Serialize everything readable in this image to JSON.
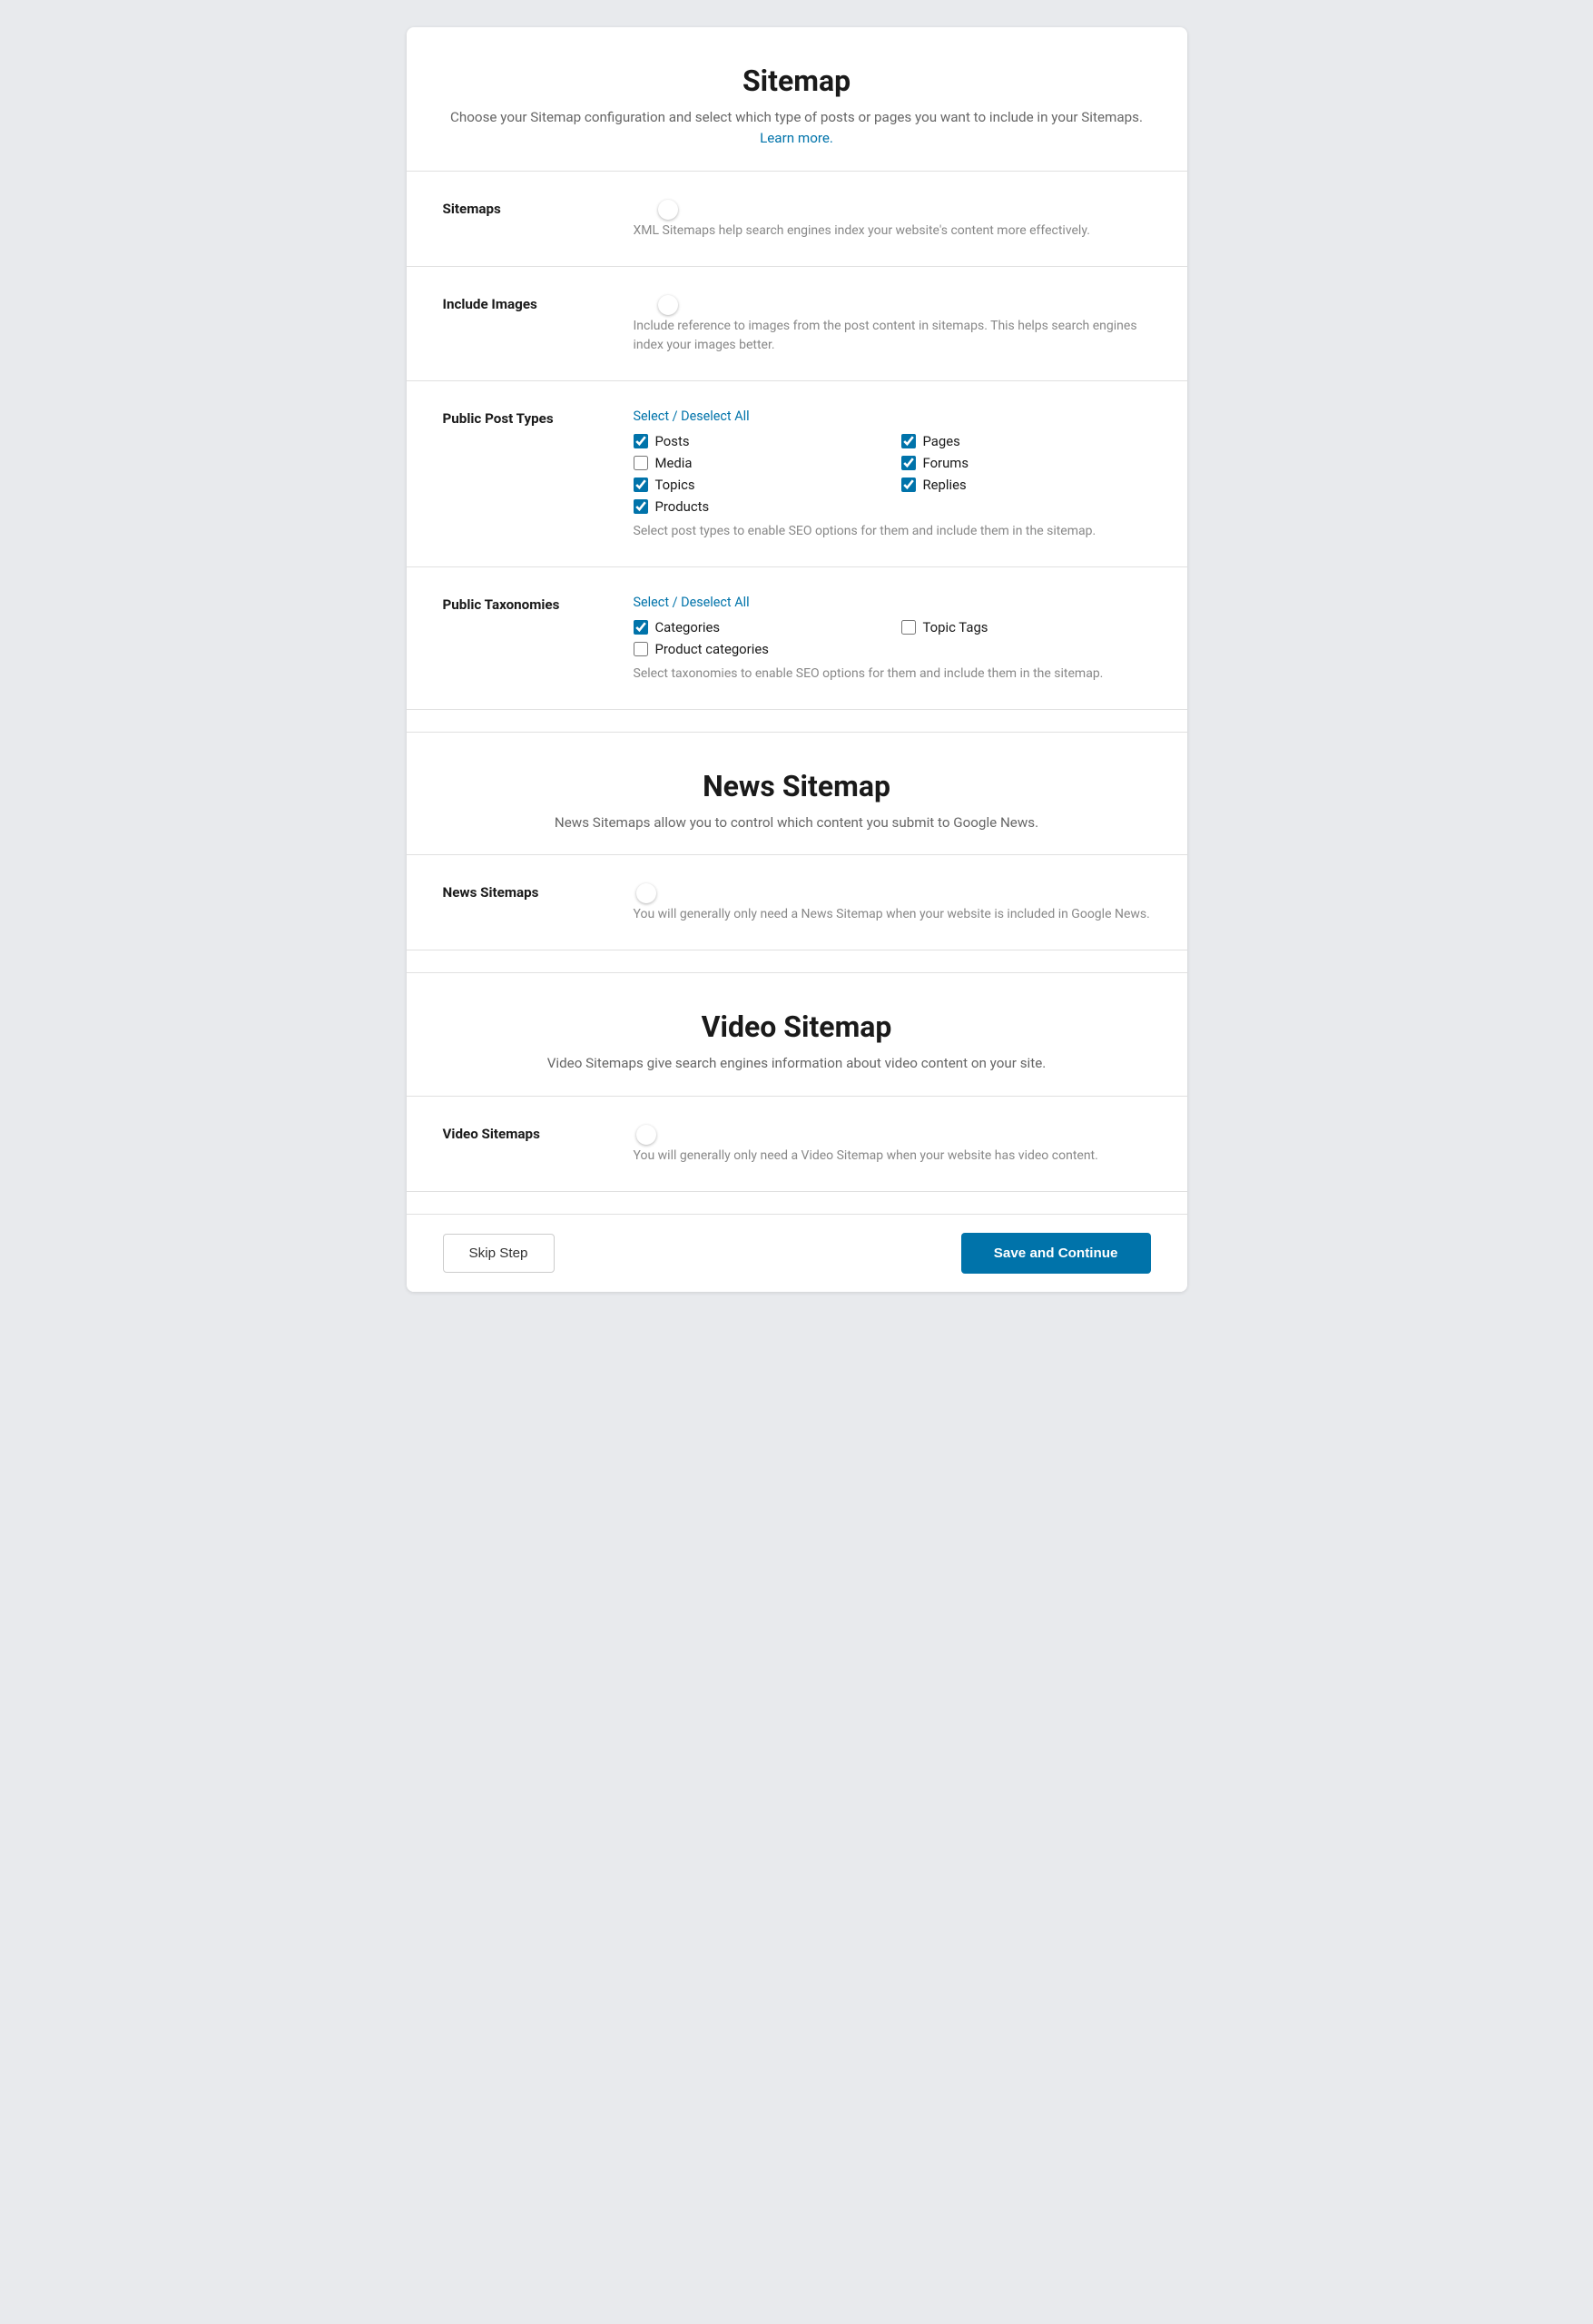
{
  "sitemap": {
    "title": "Sitemap",
    "description": "Choose your Sitemap configuration and select which type of posts or pages you want to include in your Sitemaps.",
    "learn_more_text": "Learn more.",
    "learn_more_href": "#",
    "rows": [
      {
        "id": "sitemaps",
        "label": "Sitemaps",
        "toggle_on": true,
        "description": "XML Sitemaps help search engines index your website's content more effectively."
      },
      {
        "id": "include-images",
        "label": "Include Images",
        "toggle_on": true,
        "description": "Include reference to images from the post content in sitemaps. This helps search engines index your images better."
      },
      {
        "id": "public-post-types",
        "label": "Public Post Types",
        "has_checkboxes": true,
        "select_deselect_label": "Select / Deselect All",
        "checkboxes": [
          {
            "id": "posts",
            "label": "Posts",
            "checked": true
          },
          {
            "id": "pages",
            "label": "Pages",
            "checked": true
          },
          {
            "id": "media",
            "label": "Media",
            "checked": false
          },
          {
            "id": "forums",
            "label": "Forums",
            "checked": true
          },
          {
            "id": "topics",
            "label": "Topics",
            "checked": true
          },
          {
            "id": "replies",
            "label": "Replies",
            "checked": true
          },
          {
            "id": "products",
            "label": "Products",
            "checked": true
          }
        ],
        "description": "Select post types to enable SEO options for them and include them in the sitemap."
      },
      {
        "id": "public-taxonomies",
        "label": "Public Taxonomies",
        "has_checkboxes": true,
        "select_deselect_label": "Select / Deselect All",
        "checkboxes": [
          {
            "id": "categories",
            "label": "Categories",
            "checked": true
          },
          {
            "id": "topic-tags",
            "label": "Topic Tags",
            "checked": false
          },
          {
            "id": "product-categories",
            "label": "Product categories",
            "checked": false
          }
        ],
        "description": "Select taxonomies to enable SEO options for them and include them in the sitemap."
      }
    ]
  },
  "news_sitemap": {
    "title": "News Sitemap",
    "description": "News Sitemaps allow you to control which content you submit to Google News.",
    "rows": [
      {
        "id": "news-sitemaps",
        "label": "News Sitemaps",
        "toggle_on": false,
        "description": "You will generally only need a News Sitemap when your website is included in Google News."
      }
    ]
  },
  "video_sitemap": {
    "title": "Video Sitemap",
    "description": "Video Sitemaps give search engines information about video content on your site.",
    "rows": [
      {
        "id": "video-sitemaps",
        "label": "Video Sitemaps",
        "toggle_on": false,
        "description": "You will generally only need a Video Sitemap when your website has video content."
      }
    ]
  },
  "footer": {
    "skip_label": "Skip Step",
    "save_label": "Save and Continue"
  }
}
